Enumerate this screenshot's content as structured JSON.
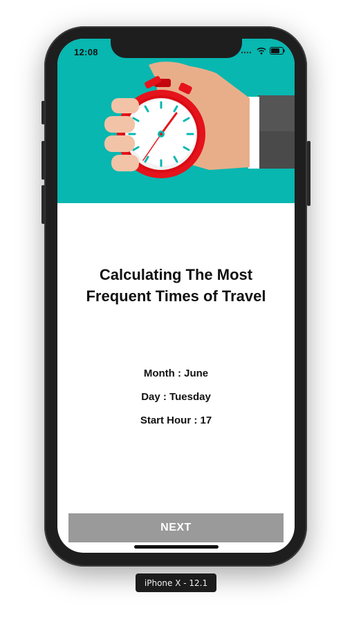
{
  "status_bar": {
    "time": "12:08",
    "icons": [
      "signal-icon",
      "wifi-icon",
      "battery-icon"
    ]
  },
  "hero": {
    "image": "hand-holding-stopwatch",
    "background_color": "#07b7b0"
  },
  "heading": {
    "line1": "Calculating The Most",
    "line2": "Frequent Times of Travel"
  },
  "details": {
    "month": "Month : June",
    "day": "Day : Tuesday",
    "start_hour": "Start Hour : 17"
  },
  "actions": {
    "next_label": "NEXT",
    "next_color": "#9a9a9a"
  },
  "device_label": "iPhone X - 12.1"
}
